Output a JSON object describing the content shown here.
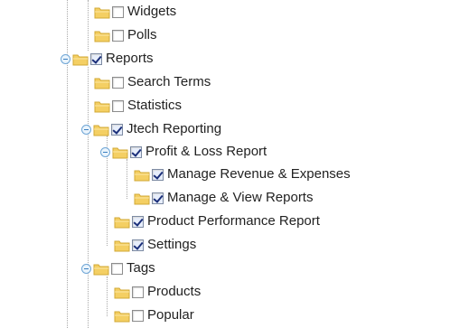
{
  "tree": {
    "items": [
      {
        "label": "Widgets",
        "checked": false,
        "toggle": false
      },
      {
        "label": "Polls",
        "checked": false,
        "toggle": false
      },
      {
        "label": "Reports",
        "checked": true,
        "toggle": true
      },
      {
        "label": "Search Terms",
        "checked": false,
        "toggle": false
      },
      {
        "label": "Statistics",
        "checked": false,
        "toggle": false
      },
      {
        "label": "Jtech Reporting",
        "checked": true,
        "toggle": true
      },
      {
        "label": "Profit & Loss Report",
        "checked": true,
        "toggle": true
      },
      {
        "label": "Manage Revenue & Expenses",
        "checked": true,
        "toggle": false
      },
      {
        "label": "Manage & View Reports",
        "checked": true,
        "toggle": false
      },
      {
        "label": "Product Performance Report",
        "checked": true,
        "toggle": false
      },
      {
        "label": "Settings",
        "checked": true,
        "toggle": false
      },
      {
        "label": "Tags",
        "checked": false,
        "toggle": true
      },
      {
        "label": "Products",
        "checked": false,
        "toggle": false
      },
      {
        "label": "Popular",
        "checked": false,
        "toggle": false
      }
    ]
  },
  "colors": {
    "folder": "#f4cf63",
    "toggle": "#3b7fc0",
    "check": "#1b2f7a"
  }
}
